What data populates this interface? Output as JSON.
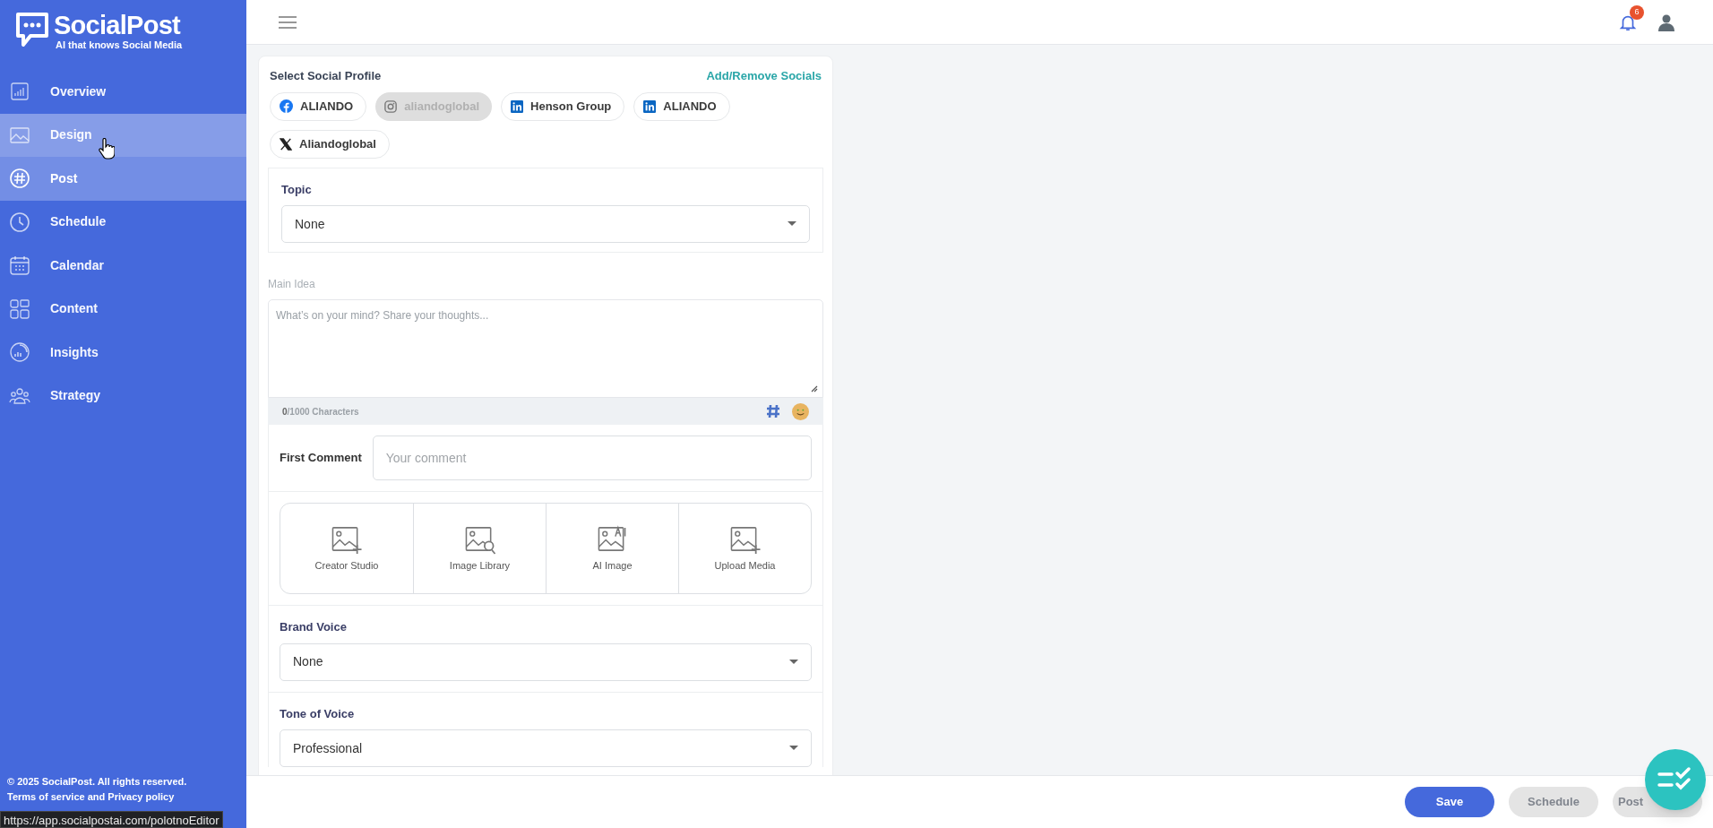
{
  "brand": {
    "name": "SocialPost",
    "tagline": "AI that knows Social Media"
  },
  "sidebar": {
    "items": [
      {
        "label": "Overview",
        "selected": false,
        "hovered": false
      },
      {
        "label": "Design",
        "selected": false,
        "hovered": true
      },
      {
        "label": "Post",
        "selected": true,
        "hovered": false
      },
      {
        "label": "Schedule",
        "selected": false,
        "hovered": false
      },
      {
        "label": "Calendar",
        "selected": false,
        "hovered": false
      },
      {
        "label": "Content",
        "selected": false,
        "hovered": false
      },
      {
        "label": "Insights",
        "selected": false,
        "hovered": false
      },
      {
        "label": "Strategy",
        "selected": false,
        "hovered": false
      }
    ],
    "footer": [
      "© 2025 SocialPost. All rights reserved.",
      "Terms of service and Privacy policy"
    ]
  },
  "header": {
    "notification_count": "6"
  },
  "profiles": {
    "title": "Select Social Profile",
    "link": "Add/Remove Socials",
    "items": [
      {
        "kind": "facebook",
        "label": "ALIANDO",
        "disabled": false
      },
      {
        "kind": "instagram",
        "label": "aliandoglobal",
        "disabled": true
      },
      {
        "kind": "linkedin",
        "label": "Henson Group",
        "disabled": false
      },
      {
        "kind": "linkedin",
        "label": "ALIANDO",
        "disabled": false
      },
      {
        "kind": "x",
        "label": "Aliandoglobal",
        "disabled": false
      }
    ]
  },
  "topic": {
    "label": "Topic",
    "value": "None"
  },
  "main_idea": {
    "label": "Main Idea",
    "placeholder": "What’s on your mind? Share your thoughts...",
    "count": "0",
    "limit": "/1000 Characters"
  },
  "first_comment": {
    "label": "First Comment",
    "placeholder": "Your comment"
  },
  "media_options": [
    {
      "label": "Creator Studio"
    },
    {
      "label": "Image Library"
    },
    {
      "label": "AI Image"
    },
    {
      "label": "Upload Media"
    }
  ],
  "brand_voice": {
    "label": "Brand Voice",
    "value": "None"
  },
  "tone_of_voice": {
    "label": "Tone of Voice",
    "value": "Professional"
  },
  "actions": [
    {
      "label": "Save",
      "disabled": false
    },
    {
      "label": "Schedule",
      "disabled": true
    },
    {
      "label": "Post",
      "disabled": true
    }
  ],
  "status_url": "https://app.socialpostai.com/polotnoEditor"
}
